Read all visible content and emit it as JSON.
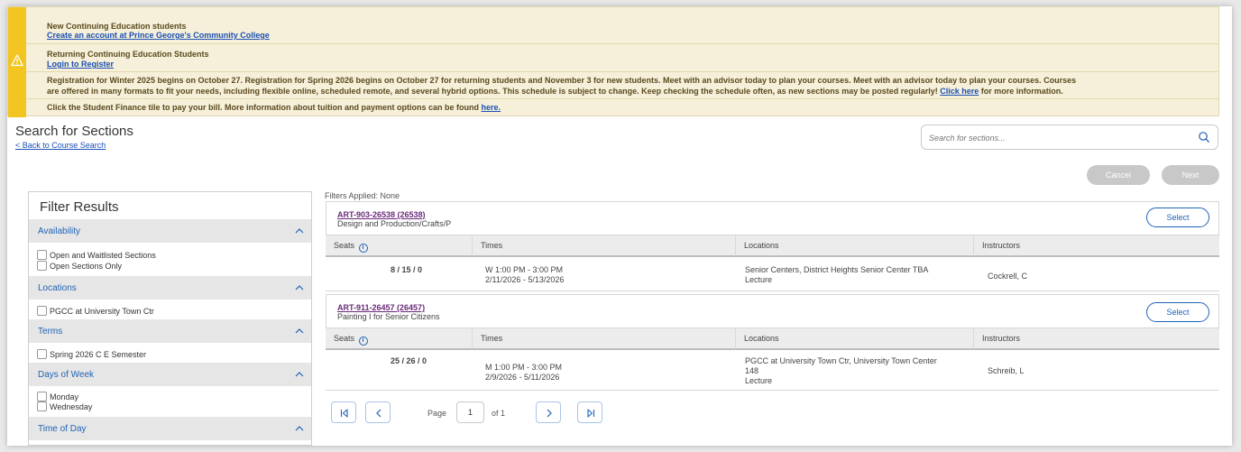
{
  "notice": {
    "new_ce_heading": "New Continuing Education students",
    "new_ce_link": "Create an account at Prince George's Community College",
    "returning_heading": "Returning Continuing Education Students",
    "returning_link": "Login to Register",
    "registration_line1": "Registration for Winter 2025 begins on October 27. Registration for Spring 2026 begins on October 27 for returning students and November 3 for new students. Meet with an advisor today to plan your courses. Meet with an advisor today to plan your courses. Courses",
    "registration_line2": "are offered in many formats to fit your needs, including flexible online, scheduled remote, and several hybrid options. This schedule is subject to change. Keep checking the schedule often, as new sections may be posted regularly!",
    "registration_link": "Click here",
    "registration_tail": "for more information.",
    "finance_text": "Click the Student Finance tile to pay your bill. More information about tuition and payment options can be found",
    "finance_link": "here."
  },
  "header": {
    "title": "Search for Sections",
    "back_link": "Back to Course Search",
    "search_placeholder": "Search for sections...",
    "cancel_label": "Cancel",
    "next_label": "Next"
  },
  "filter": {
    "title": "Filter Results",
    "groups": [
      {
        "label": "Availability",
        "options": [
          "Open and Waitlisted Sections",
          "Open Sections Only"
        ]
      },
      {
        "label": "Locations",
        "options": [
          "PGCC at University Town Ctr"
        ]
      },
      {
        "label": "Terms",
        "options": [
          "Spring 2026 C E Semester"
        ]
      },
      {
        "label": "Days of Week",
        "options": [
          "Monday",
          "Wednesday"
        ]
      },
      {
        "label": "Time of Day",
        "options": []
      }
    ]
  },
  "results": {
    "filters_applied": "Filters Applied: None",
    "select_label": "Select",
    "columns": {
      "seats": "Seats",
      "times": "Times",
      "locations": "Locations",
      "instructors": "Instructors"
    },
    "sections": [
      {
        "code": "ART-903-26538 (26538)",
        "title": "Design and Production/Crafts/P",
        "seats": "8 / 15 / 0",
        "time": "W 1:00 PM - 3:00 PM",
        "dates": "2/11/2026 - 5/13/2026",
        "location_lines": [
          "Senior Centers, District Heights Senior Center TBA",
          "Lecture"
        ],
        "instructor": "Cockrell, C"
      },
      {
        "code": "ART-911-26457 (26457)",
        "title": "Painting I for Senior Citizens",
        "seats": "25 / 26 / 0",
        "time": "M 1:00 PM - 3:00 PM",
        "dates": "2/9/2026 - 5/11/2026",
        "location_lines": [
          "PGCC at University Town Ctr, University Town Center",
          "148",
          "Lecture"
        ],
        "instructor": "Schreib, L"
      }
    ]
  },
  "pagination": {
    "page_label": "Page",
    "page_value": "1",
    "of_label": "of 1"
  },
  "icons": {
    "warning": "warning-triangle-icon",
    "search": "search-icon",
    "chevron": "chevron-up-icon",
    "info": "info-icon",
    "first": "first-page-icon",
    "prev": "previous-page-icon",
    "next": "next-page-icon",
    "last": "last-page-icon"
  },
  "colors": {
    "notice_bg": "#f6f0da",
    "notice_stripe": "#f2c521",
    "link": "#1a4fb5",
    "accent": "#1f63b6",
    "course_link": "#6a2b7a"
  }
}
